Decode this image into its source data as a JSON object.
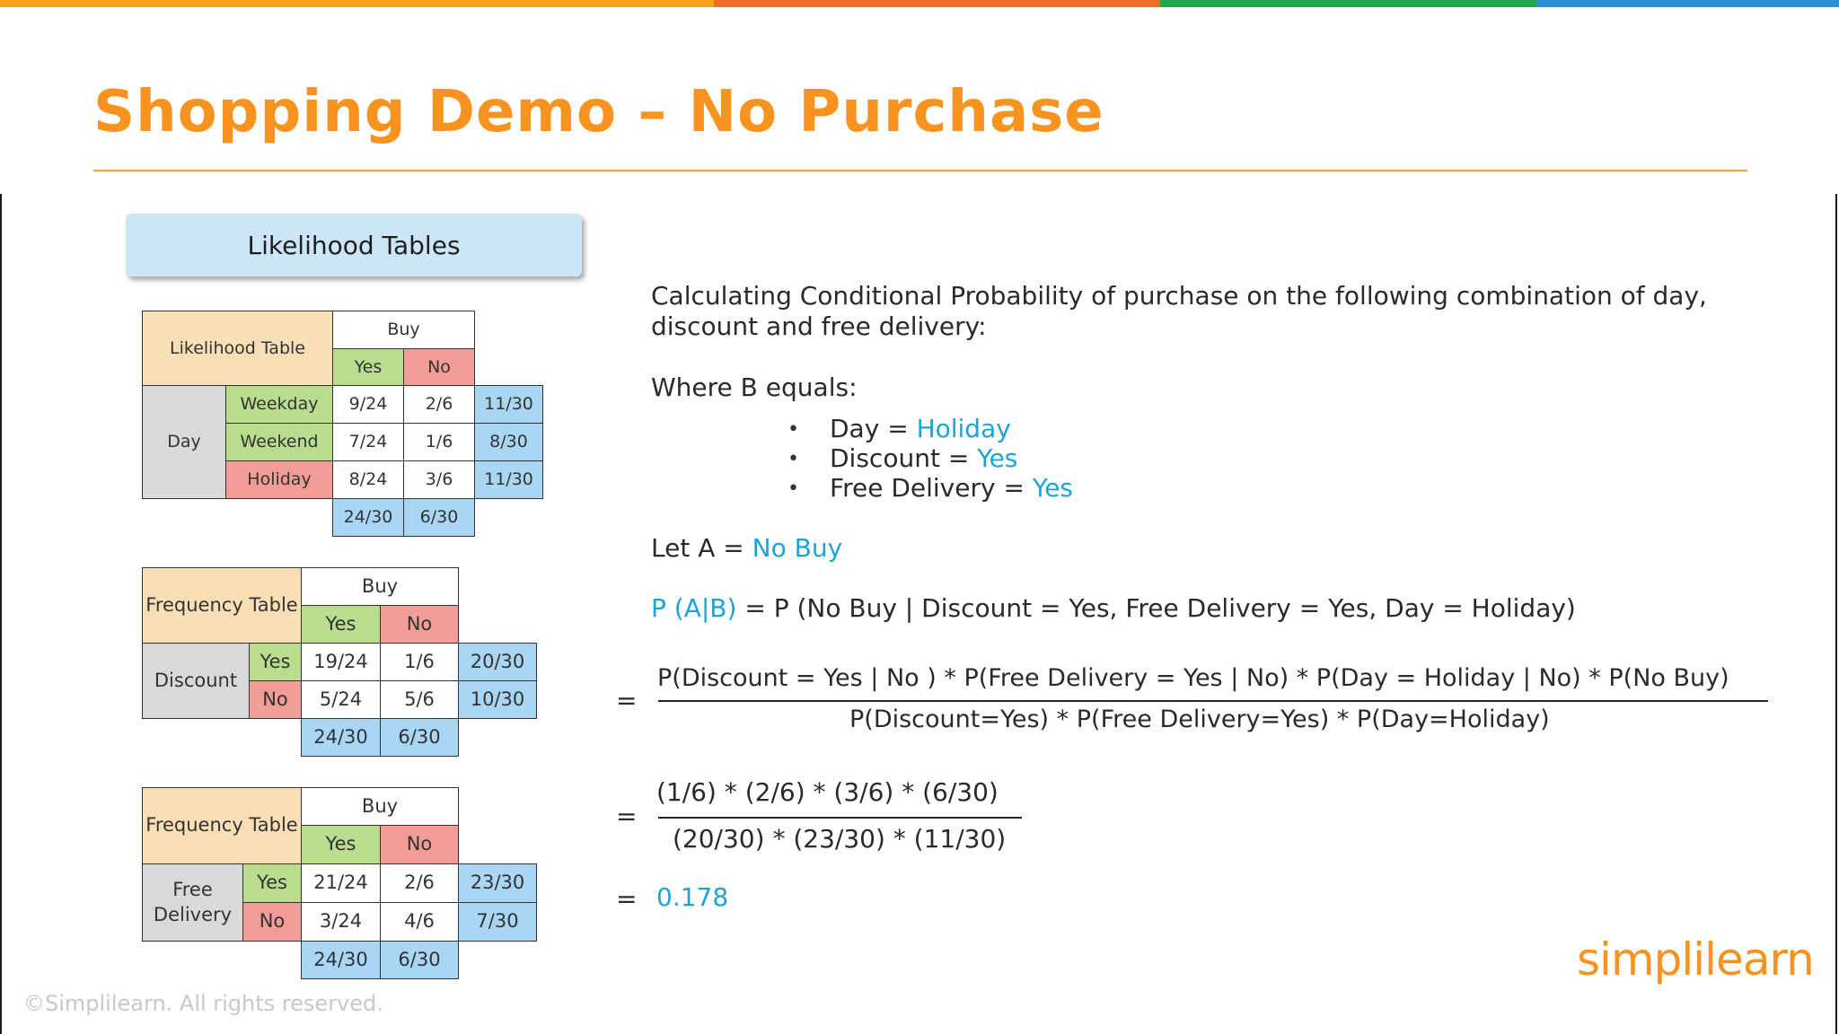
{
  "colors": {
    "accent": "#1ea3d9",
    "title": "#f7931e"
  },
  "title": "Shopping Demo – No Purchase",
  "badge": "Likelihood Tables",
  "table1": {
    "corner": "Likelihood Table",
    "buy": "Buy",
    "yes": "Yes",
    "no": "No",
    "group": "Day",
    "rows": [
      {
        "label": "Weekday",
        "yes": "9/24",
        "no": "2/6",
        "total": "11/30"
      },
      {
        "label": "Weekend",
        "yes": "7/24",
        "no": "1/6",
        "total": "8/30"
      },
      {
        "label": "Holiday",
        "yes": "8/24",
        "no": "3/6",
        "total": "11/30"
      }
    ],
    "totals": {
      "yes": "24/30",
      "no": "6/30"
    }
  },
  "table2": {
    "corner": "Frequency Table",
    "buy": "Buy",
    "yes": "Yes",
    "no": "No",
    "group": "Discount",
    "rows": [
      {
        "label": "Yes",
        "yes": "19/24",
        "no": "1/6",
        "total": "20/30"
      },
      {
        "label": "No",
        "yes": "5/24",
        "no": "5/6",
        "total": "10/30"
      }
    ],
    "totals": {
      "yes": "24/30",
      "no": "6/30"
    }
  },
  "table3": {
    "corner": "Frequency Table",
    "buy": "Buy",
    "yes": "Yes",
    "no": "No",
    "group": "Free Delivery",
    "rows": [
      {
        "label": "Yes",
        "yes": "21/24",
        "no": "2/6",
        "total": "23/30"
      },
      {
        "label": "No",
        "yes": "3/24",
        "no": "4/6",
        "total": "7/30"
      }
    ],
    "totals": {
      "yes": "24/30",
      "no": "6/30"
    }
  },
  "intro": {
    "line1": "Calculating Conditional Probability of purchase on the following combination of day,",
    "line2": "discount and free delivery:"
  },
  "where": "Where B equals:",
  "bullet": "•",
  "conditions": [
    {
      "label": "Day = ",
      "value": "Holiday"
    },
    {
      "label": "Discount = ",
      "value": "Yes"
    },
    {
      "label": "Free Delivery = ",
      "value": "Yes"
    }
  ],
  "let_a": {
    "label": "Let A = ",
    "value": "No Buy"
  },
  "pab": {
    "lhs": "P (A|B)",
    "rhs": " = P (No Buy | Discount = Yes, Free Delivery = Yes, Day = Holiday)"
  },
  "equals": "=",
  "formula": {
    "numerator": "P(Discount = Yes | No ) * P(Free Delivery = Yes | No) * P(Day = Holiday | No) * P(No Buy)",
    "denominator": "P(Discount=Yes) * P(Free Delivery=Yes) *  P(Day=Holiday)"
  },
  "numeric": {
    "numerator": "(1/6) * (2/6) * (3/6) * (6/30)",
    "denominator": "(20/30) * (23/30) * (11/30)"
  },
  "result": "0.178",
  "logo": "simplilearn",
  "copyright": "©Simplilearn. All rights reserved."
}
